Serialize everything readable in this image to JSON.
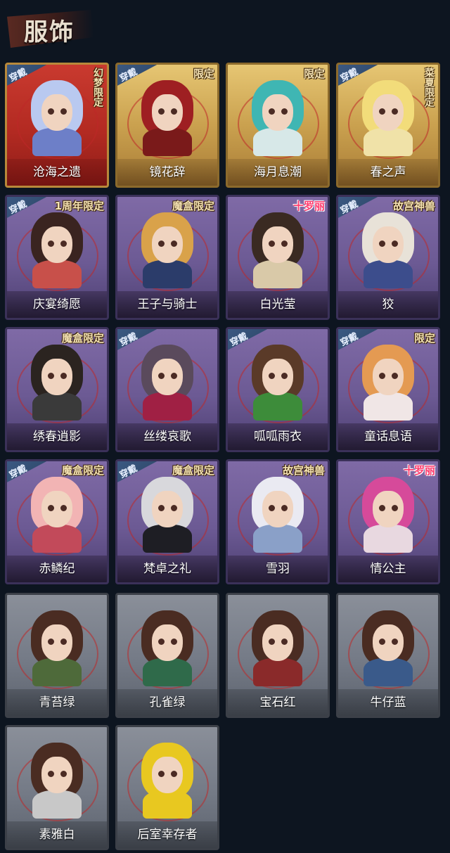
{
  "header": {
    "title": "服饰"
  },
  "labels": {
    "wear": "穿戴"
  },
  "cards": [
    {
      "name": "沧海之遗",
      "frame": "red",
      "wearing": true,
      "badge": "幻梦限定",
      "badge_style": "vertical",
      "hair": "#b9c9f0",
      "body": "#6d7fc8"
    },
    {
      "name": "镜花辞",
      "frame": "gold",
      "wearing": true,
      "badge": "限定",
      "badge_style": "normal",
      "hair": "#9e1f22",
      "body": "#7a1a1a"
    },
    {
      "name": "海月息潮",
      "frame": "gold",
      "wearing": false,
      "badge": "限定",
      "badge_style": "normal",
      "hair": "#3fb6b3",
      "body": "#d7e8e8"
    },
    {
      "name": "春之声",
      "frame": "gold",
      "wearing": true,
      "badge": "菜夏限定",
      "badge_style": "vertical",
      "hair": "#f2dc7a",
      "body": "#f0e2a8"
    },
    {
      "name": "庆宴绮愿",
      "frame": "purple",
      "wearing": true,
      "badge": "1周年限定",
      "badge_style": "normal",
      "hair": "#3a2420",
      "body": "#c8504a"
    },
    {
      "name": "王子与骑士",
      "frame": "purple",
      "wearing": false,
      "badge": "魔盒限定",
      "badge_style": "normal",
      "hair": "#d9a24a",
      "body": "#2b3c6a"
    },
    {
      "name": "白光莹",
      "frame": "purple",
      "wearing": false,
      "badge": "十罗丽",
      "badge_style": "pink",
      "hair": "#3a2a22",
      "body": "#d9c9a8"
    },
    {
      "name": "狡",
      "frame": "purple",
      "wearing": true,
      "badge": "故宫神兽",
      "badge_style": "normal",
      "hair": "#e8e2d8",
      "body": "#3c4d8c"
    },
    {
      "name": "绣春逍影",
      "frame": "purple",
      "wearing": false,
      "badge": "魔盒限定",
      "badge_style": "normal",
      "hair": "#2b2420",
      "body": "#3a3a3a"
    },
    {
      "name": "丝缕哀歌",
      "frame": "purple",
      "wearing": true,
      "badge": "",
      "badge_style": "normal",
      "hair": "#5a4a5c",
      "body": "#a02044"
    },
    {
      "name": "呱呱雨衣",
      "frame": "purple",
      "wearing": true,
      "badge": "",
      "badge_style": "normal",
      "hair": "#5a3a28",
      "body": "#3d8c3a"
    },
    {
      "name": "童话息语",
      "frame": "purple",
      "wearing": true,
      "badge": "限定",
      "badge_style": "normal",
      "hair": "#e49a52",
      "body": "#f0e6e6"
    },
    {
      "name": "赤鳞纪",
      "frame": "purple",
      "wearing": true,
      "badge": "魔盒限定",
      "badge_style": "normal",
      "hair": "#f2b4b4",
      "body": "#c24a5a"
    },
    {
      "name": "梵卓之礼",
      "frame": "purple",
      "wearing": true,
      "badge": "魔盒限定",
      "badge_style": "normal",
      "hair": "#d8d8dc",
      "body": "#1e1e24"
    },
    {
      "name": "雪羽",
      "frame": "purple",
      "wearing": false,
      "badge": "故宫神兽",
      "badge_style": "normal",
      "hair": "#eaeaf2",
      "body": "#8aa0c8"
    },
    {
      "name": "情公主",
      "frame": "purple",
      "wearing": false,
      "badge": "十罗丽",
      "badge_style": "pink",
      "hair": "#d64a9a",
      "body": "#e8d8e0"
    },
    {
      "name": "青苔绿",
      "frame": "gray",
      "wearing": false,
      "badge": "",
      "badge_style": "normal",
      "hair": "#4a2c22",
      "body": "#4e6a3a"
    },
    {
      "name": "孔雀绿",
      "frame": "gray",
      "wearing": false,
      "badge": "",
      "badge_style": "normal",
      "hair": "#4a2c22",
      "body": "#2f6a4a"
    },
    {
      "name": "宝石红",
      "frame": "gray",
      "wearing": false,
      "badge": "",
      "badge_style": "normal",
      "hair": "#4a2c22",
      "body": "#8a2a2a"
    },
    {
      "name": "牛仔蓝",
      "frame": "gray",
      "wearing": false,
      "badge": "",
      "badge_style": "normal",
      "hair": "#4a2c22",
      "body": "#3a5a8a"
    },
    {
      "name": "素雅白",
      "frame": "gray",
      "wearing": false,
      "badge": "",
      "badge_style": "normal",
      "hair": "#4a2c22",
      "body": "#c8c8c8"
    },
    {
      "name": "后室幸存者",
      "frame": "gray",
      "wearing": false,
      "badge": "",
      "badge_style": "normal",
      "hair": "#e8c820",
      "body": "#e8c820"
    }
  ]
}
